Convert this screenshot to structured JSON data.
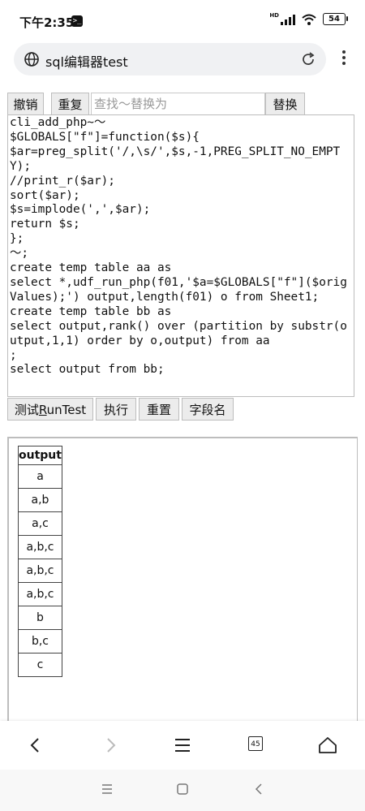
{
  "status_bar": {
    "time": "下午2:35",
    "battery": "54"
  },
  "browser": {
    "page_title": "sql编辑器test",
    "tab_count": "45"
  },
  "toolbar": {
    "undo_label": "撤销",
    "redo_label": "重复",
    "search_placeholder": "查找～替换为",
    "replace_label": "替换"
  },
  "editor": {
    "lines": [
      "cli_add_php~～",
      "$GLOBALS[\"f\"]=function($s){",
      "$ar=preg_split('/,\\s/',$s,-1,PREG_SPLIT_NO_EMPTY);",
      "//print_r($ar);",
      "sort($ar);",
      "$s=implode(',',$ar);",
      "return $s;",
      "};",
      "～;",
      "create temp table aa as",
      "select *,udf_run_php(f01,'$a=$GLOBALS[\"f\"]($origValues);') output,length(f01) o from Sheet1;",
      "create temp table bb as",
      "select output,rank() over (partition by substr(output,1,1) order by o,output) from aa",
      ";",
      "select output from bb;"
    ]
  },
  "actions": {
    "test_prefix": "测试",
    "test_underlined": "R",
    "test_suffix": "unTest",
    "run_label": "执行",
    "reset_label": "重置",
    "fields_label": "字段名"
  },
  "results": {
    "header": "output",
    "rows": [
      "a",
      "a,b",
      "a,c",
      "a,b,c",
      "a,b,c",
      "a,b,c",
      "b",
      "b,c",
      "c"
    ]
  }
}
